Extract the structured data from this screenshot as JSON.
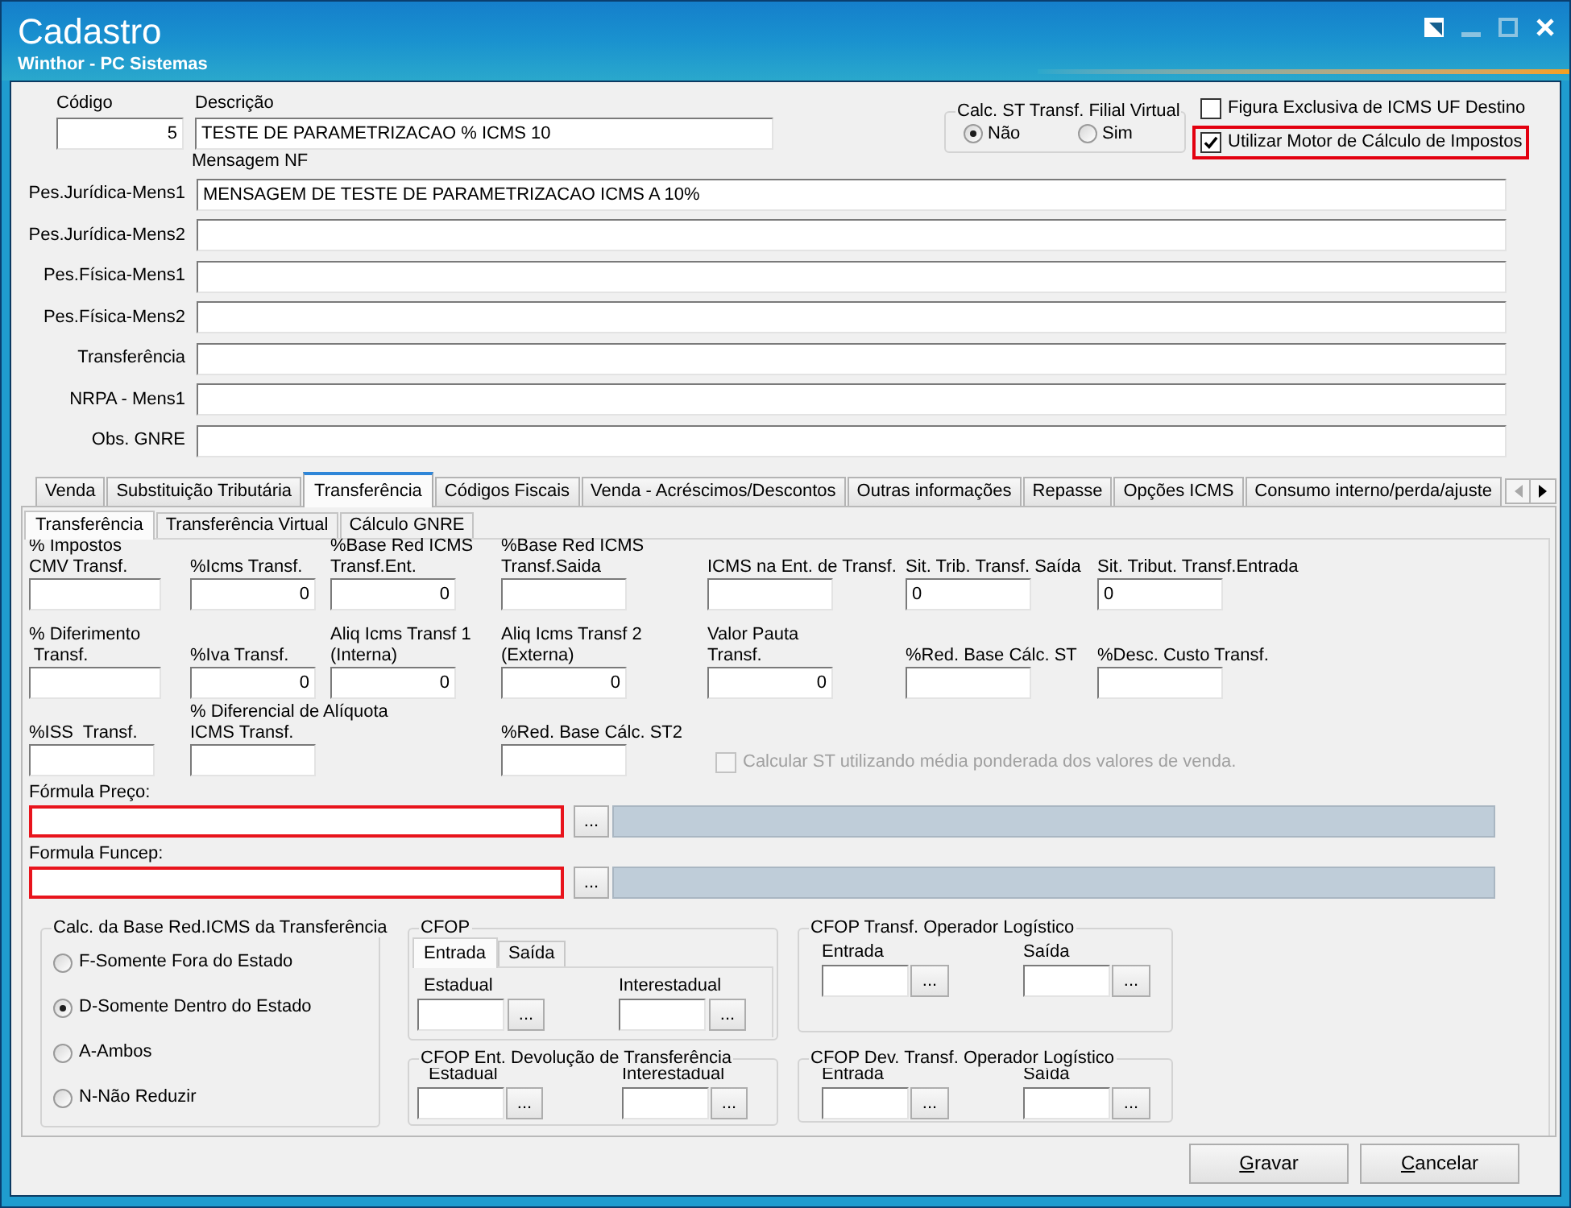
{
  "window": {
    "title": "Cadastro",
    "subtitle": "Winthor - PC Sistemas",
    "controls": [
      {
        "kind": "dock",
        "disabled": false
      },
      {
        "kind": "minimize",
        "disabled": true
      },
      {
        "kind": "maximize",
        "disabled": true
      },
      {
        "kind": "close",
        "disabled": false
      }
    ]
  },
  "header": {
    "code": {
      "label": "Código",
      "value": "5"
    },
    "description": {
      "label": "Descrição",
      "value": "TESTE DE PARAMETRIZACAO % ICMS 10"
    },
    "calc_st_filial_virtual": {
      "title": "Calc. ST Transf. Filial Virtual",
      "options": [
        {
          "label": "Não",
          "selected": true
        },
        {
          "label": "Sim",
          "selected": false
        }
      ]
    },
    "options": [
      {
        "label": "Figura Exclusiva de ICMS UF Destino",
        "checked": false,
        "highlighted": false
      },
      {
        "label": "Utilizar Motor de Cálculo de Impostos",
        "checked": true,
        "highlighted": true
      }
    ]
  },
  "nf_messages": {
    "title": "Mensagem NF",
    "rows": [
      {
        "label": "Pes.Jurídica-Mens1",
        "value": "MENSAGEM DE TESTE DE PARAMETRIZACAO ICMS A 10%"
      },
      {
        "label": "Pes.Jurídica-Mens2"
      },
      {
        "label": "Pes.Física-Mens1"
      },
      {
        "label": "Pes.Física-Mens2"
      },
      {
        "label": "Transferência"
      },
      {
        "label": "NRPA - Mens1"
      },
      {
        "label": "Obs. GNRE"
      }
    ]
  },
  "tabs": [
    {
      "label": "Venda",
      "selected": false
    },
    {
      "label": "Substituição Tributária",
      "selected": false
    },
    {
      "label": "Transferência",
      "selected": true
    },
    {
      "label": "Códigos Fiscais",
      "selected": false
    },
    {
      "label": "Venda - Acréscimos/Descontos",
      "selected": false
    },
    {
      "label": "Outras informações",
      "selected": false
    },
    {
      "label": "Repasse",
      "selected": false
    },
    {
      "label": "Opções ICMS",
      "selected": false
    },
    {
      "label": "Consumo interno/perda/ajuste",
      "selected": false
    }
  ],
  "tab_scroll": {
    "previous_disabled": true,
    "next_disabled": false
  },
  "subtabs": [
    {
      "label": "Transferência",
      "selected": true
    },
    {
      "label": "Transferência Virtual",
      "selected": false
    },
    {
      "label": "Cálculo GNRE",
      "selected": false
    }
  ],
  "fields": [
    {
      "label": "% Impostos\nCMV Transf."
    },
    {
      "label": "%Icms Transf.",
      "value": "0",
      "kind": "number"
    },
    {
      "label": "%Base Red ICMS\nTransf.Ent.",
      "value": "0",
      "kind": "number"
    },
    {
      "label": "%Base Red ICMS\nTransf.Saida"
    },
    {
      "label": "ICMS na Ent. de Transf."
    },
    {
      "label": "Sit. Trib. Transf. Saída",
      "value": "0",
      "kind": "code"
    },
    {
      "label": "Sit. Tribut. Transf.Entrada",
      "value": "0",
      "kind": "code"
    },
    {
      "label": "% Diferimento\n Transf."
    },
    {
      "label": "%Iva Transf.",
      "value": "0",
      "kind": "number"
    },
    {
      "label": "Aliq Icms Transf 1\n(Interna)",
      "value": "0",
      "kind": "number"
    },
    {
      "label": "Aliq Icms Transf 2\n(Externa)",
      "value": "0",
      "kind": "number"
    },
    {
      "label": "Valor Pauta\nTransf.",
      "value": "0",
      "kind": "number"
    },
    {
      "label": "%Red. Base Cálc. ST"
    },
    {
      "label": "%Desc. Custo Transf."
    },
    {
      "label": "%ISS  Transf."
    },
    {
      "label": "% Diferencial de Alíquota\nICMS Transf."
    },
    {
      "label": "%Red. Base Cálc. ST2"
    }
  ],
  "media_ponderada": {
    "label": "Calcular ST utilizando média ponderada dos valores de venda.",
    "checked": false,
    "disabled": true
  },
  "formulas": [
    {
      "label": "Fórmula Preço:",
      "button": "...",
      "highlighted": true
    },
    {
      "label": "Formula Funcep:",
      "button": "...",
      "highlighted": true
    }
  ],
  "base_red": {
    "title": "Calc. da Base Red.ICMS da Transferência",
    "options": [
      {
        "label": "F-Somente Fora do Estado",
        "selected": false
      },
      {
        "label": "D-Somente Dentro do Estado",
        "selected": true
      },
      {
        "label": "A-Ambos",
        "selected": false
      },
      {
        "label": "N-Não Reduzir",
        "selected": false
      }
    ]
  },
  "cfop": {
    "title": "CFOP",
    "tabs": [
      {
        "label": "Entrada",
        "selected": true
      },
      {
        "label": "Saída",
        "selected": false
      }
    ],
    "fields": [
      {
        "label": "Estadual",
        "button": "..."
      },
      {
        "label": "Interestadual",
        "button": "..."
      }
    ]
  },
  "cfop_devolucao": {
    "title": "CFOP Ent. Devolução de Transferência",
    "fields": [
      {
        "label": "Estadual",
        "button": "..."
      },
      {
        "label": "Interestadual",
        "button": "..."
      }
    ]
  },
  "cfop_operador": {
    "title": "CFOP Transf. Operador Logístico",
    "fields": [
      {
        "label": "Entrada",
        "button": "..."
      },
      {
        "label": "Saída",
        "button": "..."
      }
    ]
  },
  "cfop_dev_operador": {
    "title": "CFOP Dev. Transf. Operador Logístico",
    "fields": [
      {
        "label": "Entrada",
        "button": "..."
      },
      {
        "label": "Saída",
        "button": "..."
      }
    ]
  },
  "buttons": [
    {
      "label": "Gravar"
    },
    {
      "label": "Cancelar"
    }
  ]
}
